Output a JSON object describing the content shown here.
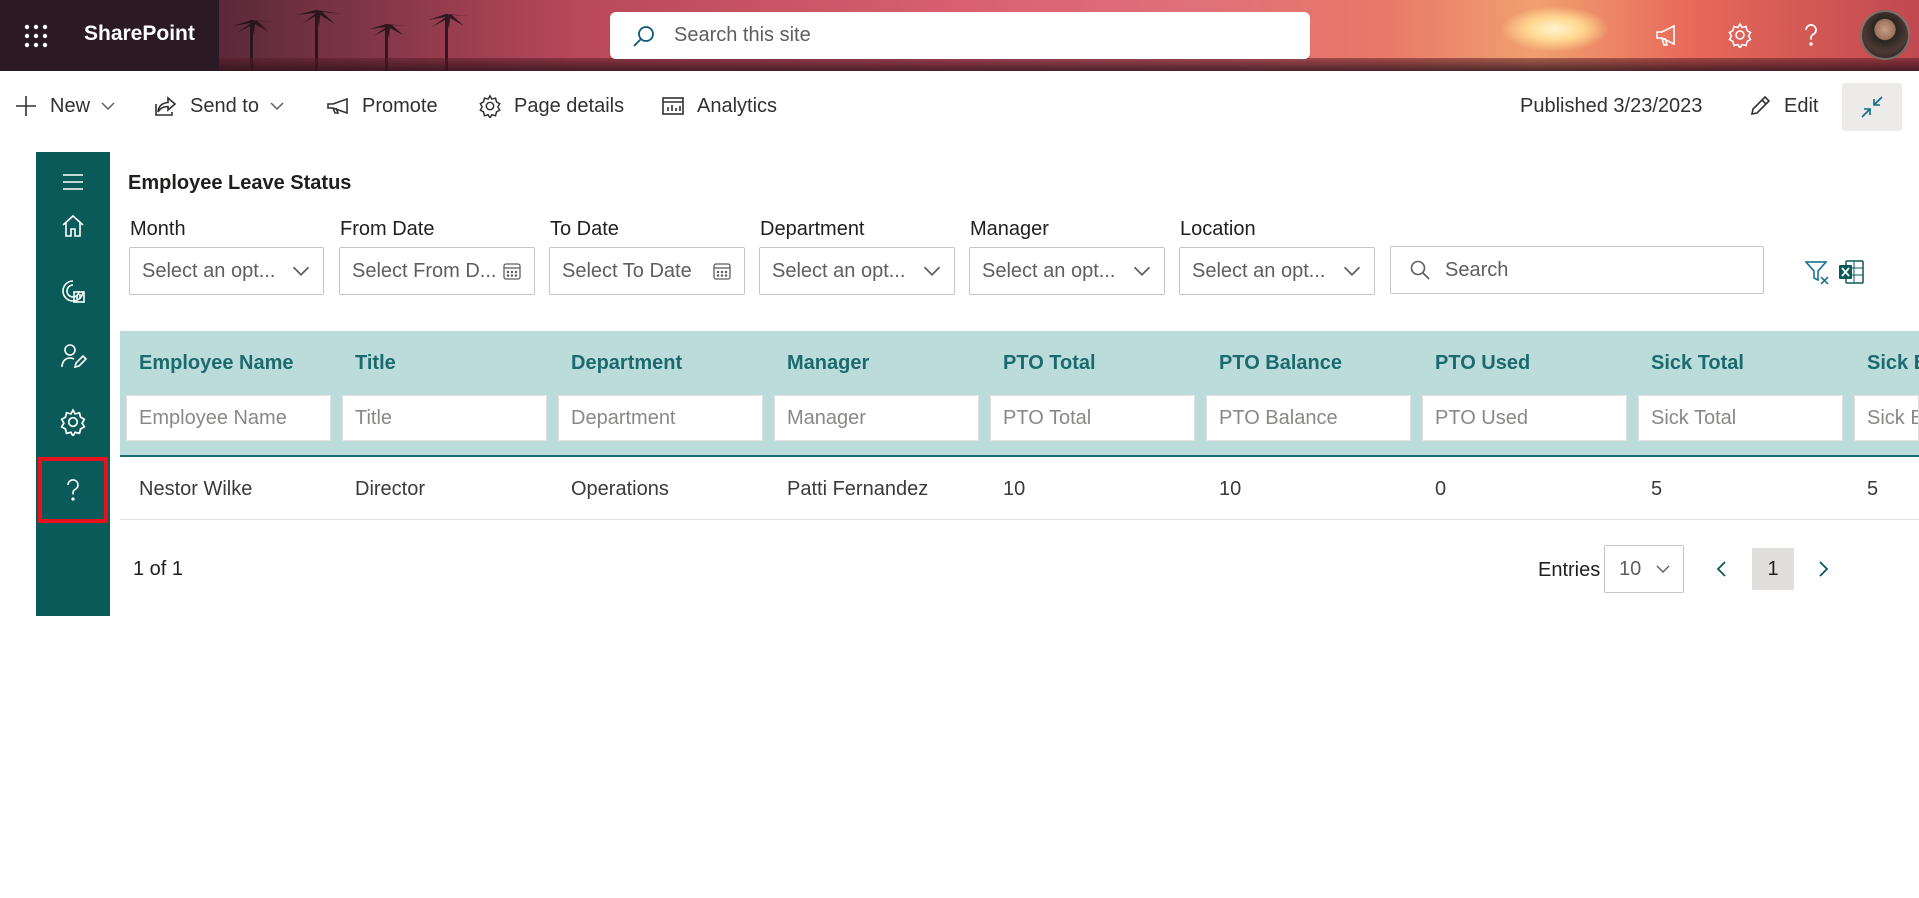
{
  "suitebar": {
    "app_name": "SharePoint",
    "search_placeholder": "Search this site"
  },
  "commandbar": {
    "new_label": "New",
    "send_to_label": "Send to",
    "promote_label": "Promote",
    "page_details_label": "Page details",
    "analytics_label": "Analytics",
    "published_text": "Published 3/23/2023",
    "edit_label": "Edit"
  },
  "sidebar": {
    "items": [
      "menu-icon",
      "home-icon",
      "leave-dashboard-icon",
      "user-edit-icon",
      "settings-icon",
      "help-icon"
    ],
    "active_item": "help-icon",
    "active_outline_color": "#e8121e"
  },
  "main": {
    "title": "Employee Leave Status",
    "filters": [
      {
        "label": "Month",
        "placeholder": "Select an opt..."
      },
      {
        "label": "From Date",
        "placeholder": "Select From D..."
      },
      {
        "label": "To Date",
        "placeholder": "Select To Date"
      },
      {
        "label": "Department",
        "placeholder": "Select an opt..."
      },
      {
        "label": "Manager",
        "placeholder": "Select an opt..."
      },
      {
        "label": "Location",
        "placeholder": "Select an opt..."
      }
    ],
    "search_placeholder": "Search"
  },
  "table": {
    "columns": [
      "Employee Name",
      "Title",
      "Department",
      "Manager",
      "PTO Total",
      "PTO Balance",
      "PTO Used",
      "Sick Total",
      "Sick B"
    ],
    "column_filters": [
      "Employee Name",
      "Title",
      "Department",
      "Manager",
      "PTO Total",
      "PTO Balance",
      "PTO Used",
      "Sick Total",
      "Sick B"
    ],
    "rows": [
      [
        "Nestor Wilke",
        "Director",
        "Operations",
        "Patti Fernandez",
        "10",
        "10",
        "0",
        "5",
        "5"
      ]
    ]
  },
  "pagination": {
    "summary": "1 of 1",
    "entries_label": "Entries",
    "entries_value": "10",
    "current_page": "1"
  },
  "colors": {
    "rail": "#0b5a5a",
    "header_bg": "#bcdcdc",
    "header_text": "#1b6b6e"
  }
}
